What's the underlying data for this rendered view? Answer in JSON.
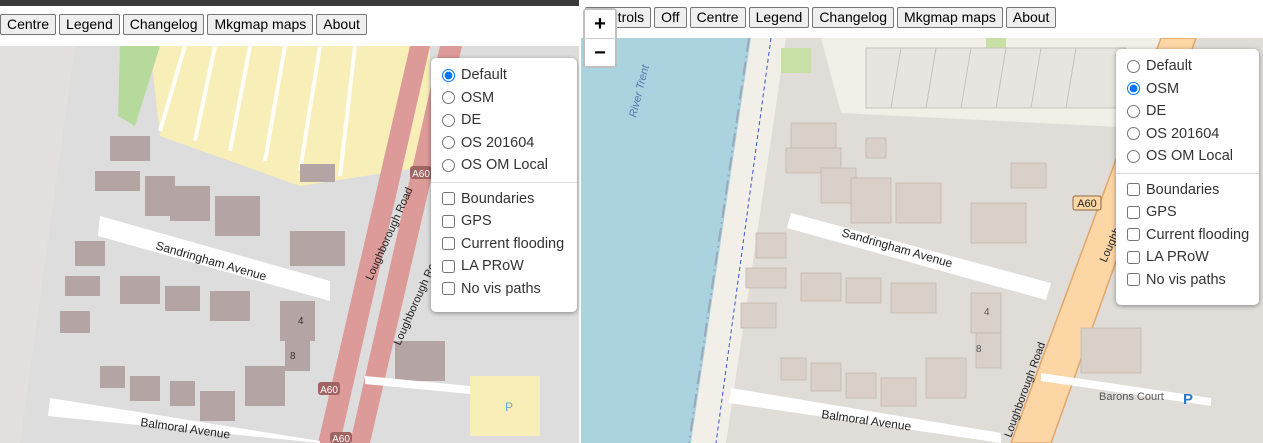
{
  "left": {
    "toolbar": [
      "Centre",
      "Legend",
      "Changelog",
      "Mkgmap maps",
      "About"
    ],
    "layers": {
      "base": [
        {
          "label": "Default",
          "checked": true
        },
        {
          "label": "OSM",
          "checked": false
        },
        {
          "label": "DE",
          "checked": false
        },
        {
          "label": "OS 201604",
          "checked": false
        },
        {
          "label": "OS OM Local",
          "checked": false
        }
      ],
      "overlays": [
        {
          "label": "Boundaries",
          "checked": false
        },
        {
          "label": "GPS",
          "checked": false
        },
        {
          "label": "Current flooding",
          "checked": false
        },
        {
          "label": "LA PRoW",
          "checked": false
        },
        {
          "label": "No vis paths",
          "checked": false
        }
      ]
    },
    "map_labels": {
      "street1": "Sandringham Avenue",
      "street2": "Loughborough Road",
      "street3": "Loughborough Road",
      "street4": "Balmoral Avenue",
      "road_ref_top": "A60",
      "road_ref_bottom": "A60",
      "road_ref_bottom2": "A60",
      "house4": "4",
      "house8": "8",
      "parking": "P"
    }
  },
  "right": {
    "toolbar": [
      "Controls",
      "Off",
      "Centre",
      "Legend",
      "Changelog",
      "Mkgmap maps",
      "About"
    ],
    "zoom": {
      "in": "+",
      "out": "−"
    },
    "layers": {
      "base": [
        {
          "label": "Default",
          "checked": false
        },
        {
          "label": "OSM",
          "checked": true
        },
        {
          "label": "DE",
          "checked": false
        },
        {
          "label": "OS 201604",
          "checked": false
        },
        {
          "label": "OS OM Local",
          "checked": false
        }
      ],
      "overlays": [
        {
          "label": "Boundaries",
          "checked": false
        },
        {
          "label": "GPS",
          "checked": false
        },
        {
          "label": "Current flooding",
          "checked": false
        },
        {
          "label": "LA PRoW",
          "checked": false
        },
        {
          "label": "No vis paths",
          "checked": false
        }
      ]
    },
    "map_labels": {
      "river": "River Trent",
      "street1": "Sandringham Avenue",
      "street2": "Loughborough Road",
      "street3": "Loughborough Road",
      "street4": "Balmoral Avenue",
      "road_ref": "A60",
      "house4": "4",
      "house8": "8",
      "place": "Barons Court",
      "parking": "P"
    }
  },
  "colors": {
    "water": "#aad3df",
    "primary_road_left": "#dc9a98",
    "primary_road_right": "#fcd6a4",
    "building_left": "#b5a4a4",
    "building_right": "#d9d0c9",
    "residential_yellow": "#f7efb7",
    "land": "#f2efe9",
    "grass": "#c8e0a6"
  }
}
